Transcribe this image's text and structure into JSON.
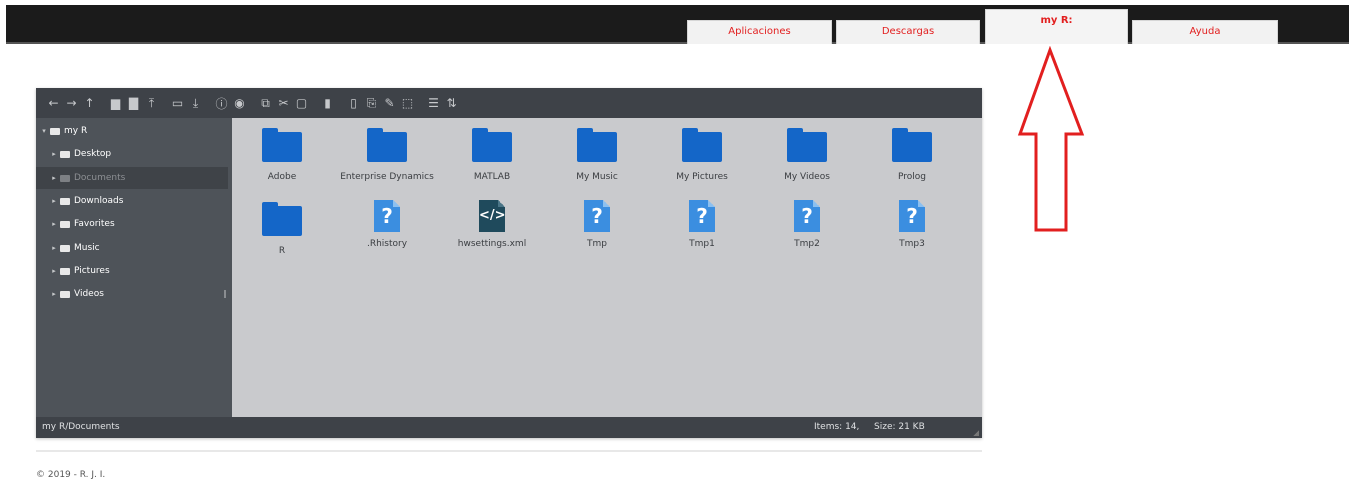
{
  "nav": {
    "tabs": [
      {
        "label": "Aplicaciones"
      },
      {
        "label": "Descargas"
      },
      {
        "label": "my R:"
      },
      {
        "label": "Ayuda"
      }
    ],
    "active_tab": "my R:",
    "accent_color": "#e21f1f"
  },
  "toolbar": {
    "buttons": [
      {
        "icon": "back-icon",
        "glyph": "←"
      },
      {
        "icon": "forward-icon",
        "glyph": "→"
      },
      {
        "icon": "up-icon",
        "glyph": "↑"
      },
      {
        "icon": "new-folder-icon",
        "glyph": "▆"
      },
      {
        "icon": "new-file-icon",
        "glyph": "▇"
      },
      {
        "icon": "upload-icon",
        "glyph": "⤒"
      },
      {
        "icon": "open-icon",
        "glyph": "▭"
      },
      {
        "icon": "download-icon",
        "glyph": "⤓"
      },
      {
        "icon": "info-icon",
        "glyph": "ⓘ"
      },
      {
        "icon": "preview-icon",
        "glyph": "◉"
      },
      {
        "icon": "copy-icon",
        "glyph": "⧉"
      },
      {
        "icon": "cut-icon",
        "glyph": "✂"
      },
      {
        "icon": "paste-icon",
        "glyph": "▢"
      },
      {
        "icon": "delete-icon",
        "glyph": "▮"
      },
      {
        "icon": "duplicate-icon",
        "glyph": "▯"
      },
      {
        "icon": "rename-icon",
        "glyph": "⎘"
      },
      {
        "icon": "edit-icon",
        "glyph": "✎"
      },
      {
        "icon": "resize-icon",
        "glyph": "⬚"
      },
      {
        "icon": "view-list-icon",
        "glyph": "☰"
      },
      {
        "icon": "sort-icon",
        "glyph": "⇅"
      }
    ]
  },
  "sidebar": {
    "root": "my R",
    "items": [
      {
        "label": "Desktop"
      },
      {
        "label": "Documents"
      },
      {
        "label": "Downloads"
      },
      {
        "label": "Favorites"
      },
      {
        "label": "Music"
      },
      {
        "label": "Pictures"
      },
      {
        "label": "Videos"
      }
    ],
    "selected": "Documents"
  },
  "files": [
    {
      "name": "Adobe",
      "type": "folder"
    },
    {
      "name": "Enterprise Dynamics",
      "type": "folder"
    },
    {
      "name": "MATLAB",
      "type": "folder"
    },
    {
      "name": "My Music",
      "type": "folder"
    },
    {
      "name": "My Pictures",
      "type": "folder"
    },
    {
      "name": "My Videos",
      "type": "folder"
    },
    {
      "name": "Prolog",
      "type": "folder"
    },
    {
      "name": "R",
      "type": "folder"
    },
    {
      "name": ".Rhistory",
      "type": "unknown"
    },
    {
      "name": "hwsettings.xml",
      "type": "code"
    },
    {
      "name": "Tmp",
      "type": "unknown"
    },
    {
      "name": "Tmp1",
      "type": "unknown"
    },
    {
      "name": "Tmp2",
      "type": "unknown"
    },
    {
      "name": "Tmp3",
      "type": "unknown"
    }
  ],
  "icons": {
    "unknown_glyph": "?",
    "code_glyph": "</>"
  },
  "status": {
    "path": "my R/Documents",
    "items": "Items: 14,",
    "size": "Size: 21 KB"
  },
  "footer": {
    "text": "© 2019 - R. J. I."
  }
}
